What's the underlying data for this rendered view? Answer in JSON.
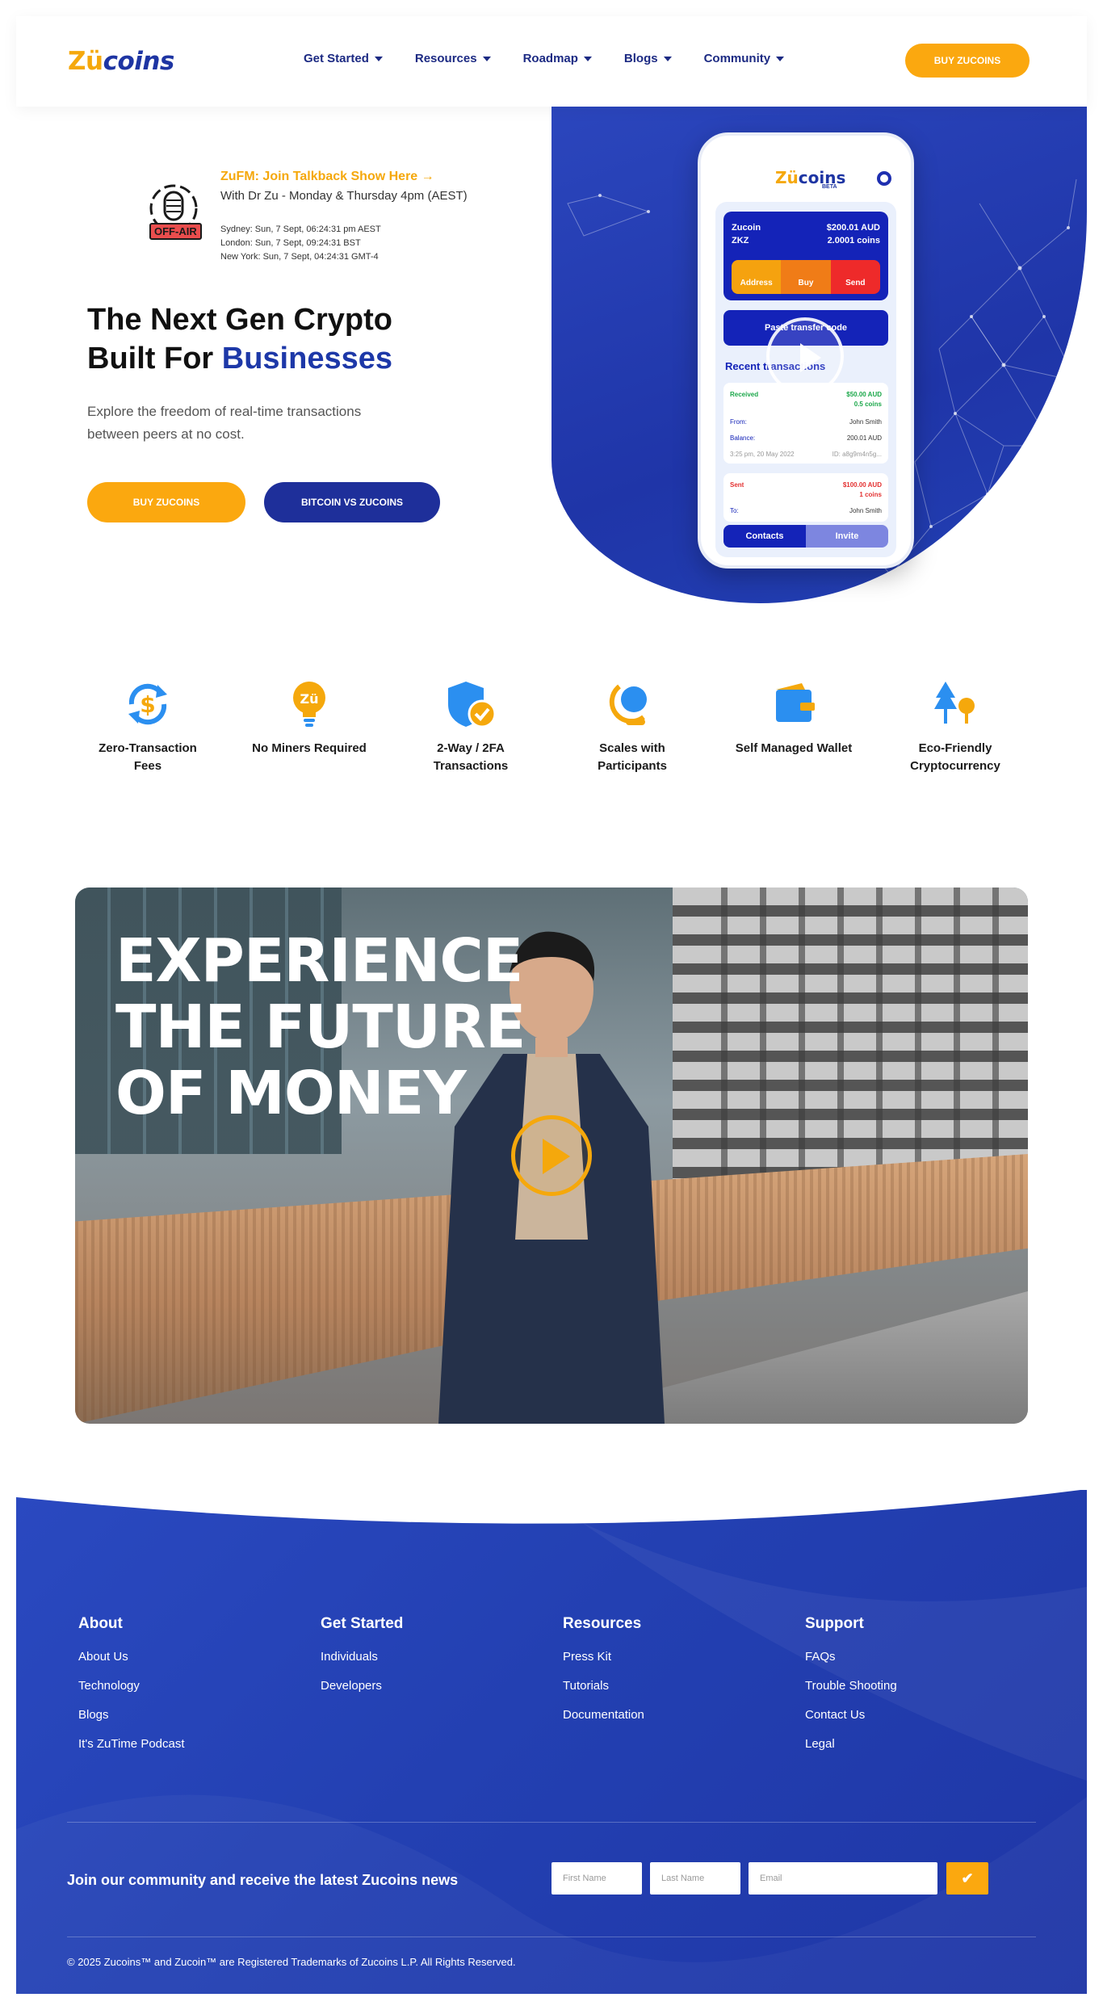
{
  "header": {
    "logo_z": "Zü",
    "logo_rest": "coins",
    "nav": [
      {
        "label": "Get Started"
      },
      {
        "label": "Resources"
      },
      {
        "label": "Roadmap"
      },
      {
        "label": "Blogs"
      },
      {
        "label": "Community"
      }
    ],
    "buy_button": "BUY ZUCOINS"
  },
  "hero": {
    "on_air_badge": "OFF-AIR",
    "talkback_link": "ZuFM: Join Talkback Show Here →",
    "talkback_sub": "With Dr Zu - Monday & Thursday 4pm (AEST)",
    "times": [
      "Sydney: Sun, 7 Sept, 06:24:31 pm AEST",
      "London: Sun, 7 Sept, 09:24:31 BST",
      "New York: Sun, 7 Sept, 04:24:31 GMT-4"
    ],
    "title_line1": "The Next Gen Crypto",
    "title_line2_prefix": "Built For ",
    "title_line2_highlight": "Businesses",
    "description": "Explore the freedom of real-time transactions between peers at no cost.",
    "buy_button": "BUY ZUCOINS",
    "vs_button": "BITCOIN VS ZUCOINS"
  },
  "phone": {
    "logo_z": "Zü",
    "logo_rest": "coins",
    "beta": "BETA",
    "coin1_name": "Zucoin",
    "coin2_name": "ZKZ",
    "coin1_value": "$200.01 AUD",
    "coin2_value": "2.0001 coins",
    "actions": [
      "Address",
      "Buy",
      "Send"
    ],
    "paste_button": "Paste transfer code",
    "recent_title": "Recent transactions",
    "tx1": {
      "type": "Received",
      "amount": "$50.00 AUD",
      "coins": "0.5 coins",
      "from_label": "From:",
      "from_value": "John Smith",
      "balance_label": "Balance:",
      "balance_value": "200.01 AUD",
      "date": "3:25 pm, 20 May 2022",
      "id": "ID: a8g9m4n5g..."
    },
    "tx2": {
      "type": "Sent",
      "amount": "$100.00 AUD",
      "coins": "1 coins",
      "to_label": "To:",
      "to_value": "John Smith"
    },
    "tabs": [
      "Contacts",
      "Invite"
    ]
  },
  "features": [
    {
      "label": "Zero-Transaction Fees",
      "icon": "dollar-exchange-icon"
    },
    {
      "label": "No Miners Required",
      "icon": "lightbulb-icon"
    },
    {
      "label": "2-Way / 2FA Transactions",
      "icon": "shield-check-icon"
    },
    {
      "label": "Scales with Participants",
      "icon": "globe-stand-icon"
    },
    {
      "label": "Self Managed Wallet",
      "icon": "wallet-icon"
    },
    {
      "label": "Eco-Friendly Cryptocurrency",
      "icon": "trees-icon"
    }
  ],
  "video": {
    "headline": "EXPERIENCE\nTHE FUTURE\nOF MONEY"
  },
  "footer": {
    "columns": [
      {
        "heading": "About",
        "links": [
          "About Us",
          "Technology",
          "Blogs",
          "It's ZuTime Podcast"
        ]
      },
      {
        "heading": "Get Started",
        "links": [
          "Individuals",
          "Developers"
        ]
      },
      {
        "heading": "Resources",
        "links": [
          "Press Kit",
          "Tutorials",
          "Documentation"
        ]
      },
      {
        "heading": "Support",
        "links": [
          "FAQs",
          "Trouble Shooting",
          "Contact Us",
          "Legal"
        ]
      }
    ],
    "newsletter_text": "Join our community and receive the latest Zucoins news",
    "first_name_placeholder": "First Name",
    "last_name_placeholder": "Last Name",
    "email_placeholder": "Email",
    "submit_icon": "check-icon",
    "copyright": "© 2025 Zucoins™ and Zucoin™ are Registered Trademarks of Zucoins L.P. All Rights Reserved."
  },
  "colors": {
    "brand_blue": "#1e35a3",
    "brand_orange": "#fba80f",
    "footer_blue": "#2340b2"
  }
}
